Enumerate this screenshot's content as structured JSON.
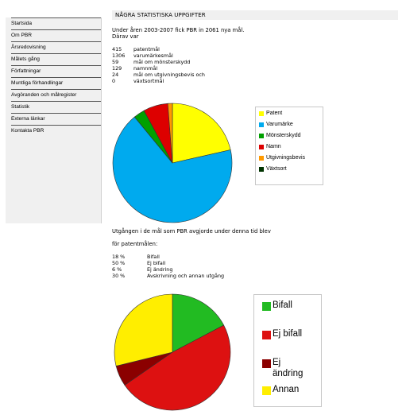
{
  "sidebar": {
    "items": [
      {
        "label": "Startsida"
      },
      {
        "label": "Om PBR"
      },
      {
        "label": "Årsredovisning"
      },
      {
        "label": "Målets gång"
      },
      {
        "label": "Författningar"
      },
      {
        "label": "Muntliga förhandlingar"
      },
      {
        "label": "Avgöranden och målregister"
      },
      {
        "label": "Statistik"
      },
      {
        "label": "Externa länkar"
      },
      {
        "label": "Kontakta PBR"
      }
    ]
  },
  "main": {
    "heading": "NÅGRA STATISTISKA UPPGIFTER",
    "intro_line1": "Under åren 2003-2007 fick PBR in 2061 nya mål.",
    "intro_line2": "Därav var",
    "case_stats": [
      {
        "count": "415",
        "label": "patentmål"
      },
      {
        "count": "1306",
        "label": "varumärkesmål"
      },
      {
        "count": "59",
        "label": "mål om mönsterskydd"
      },
      {
        "count": "129",
        "label": "namnmål"
      },
      {
        "count": "24",
        "label": "mål om utgivningsbevis och"
      },
      {
        "count": "0",
        "label": "växtsortmål"
      }
    ],
    "outcome_text": "Utgången i de mål som PBR avgjorde under denna tid blev",
    "for_patents": "för patentmålen:",
    "outcome_stats": [
      {
        "percent": "18 %",
        "label": "Bifall"
      },
      {
        "percent": "50 %",
        "label": "Ej bifall"
      },
      {
        "percent": "6 %",
        "label": "Ej ändring"
      },
      {
        "percent": "30 %",
        "label": "Avskrivning och annan utgång"
      }
    ]
  },
  "chart_data": [
    {
      "type": "pie",
      "values": [
        415,
        1306,
        59,
        129,
        24,
        0
      ],
      "categories": [
        "Patent",
        "Varumärke",
        "Mönsterskydd",
        "Namn",
        "Utgivningsbevis",
        "Växtsort"
      ],
      "colors": [
        "#ffff00",
        "#00aaee",
        "#00a000",
        "#dd0000",
        "#ff9900",
        "#003300"
      ],
      "legend": "right"
    },
    {
      "type": "pie",
      "values": [
        18,
        50,
        6,
        30
      ],
      "categories": [
        "Bifall",
        "Ej bifall",
        "Ej ändring",
        "Annan"
      ],
      "colors": [
        "#22bb22",
        "#dd1111",
        "#8b0000",
        "#ffee00"
      ],
      "legend": "right"
    }
  ]
}
